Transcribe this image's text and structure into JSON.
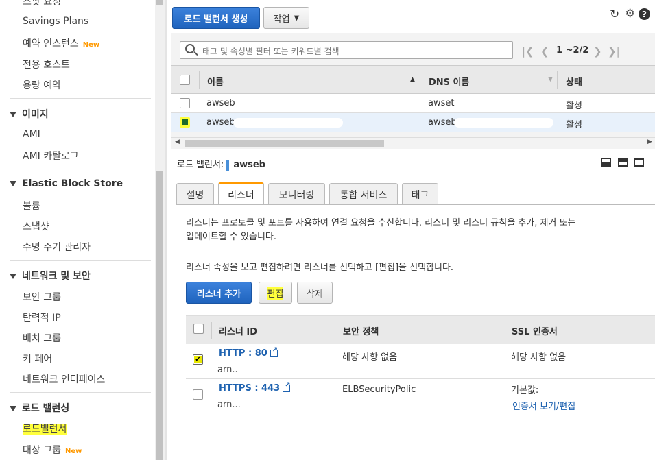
{
  "sidebar": {
    "top_partial": "스팟 요청",
    "items_a": [
      {
        "label": "Savings Plans"
      },
      {
        "label": "예약 인스턴스",
        "badge": "New"
      },
      {
        "label": "전용 호스트"
      },
      {
        "label": "용량 예약"
      }
    ],
    "section_images": "이미지",
    "images_items": [
      {
        "label": "AMI"
      },
      {
        "label": "AMI 카탈로그"
      }
    ],
    "section_ebs": "Elastic Block Store",
    "ebs_items": [
      {
        "label": "볼륨"
      },
      {
        "label": "스냅샷"
      },
      {
        "label": "수명 주기 관리자"
      }
    ],
    "section_network": "네트워크 및 보안",
    "network_items": [
      {
        "label": "보안 그룹"
      },
      {
        "label": "탄력적 IP"
      },
      {
        "label": "배치 그룹"
      },
      {
        "label": "키 페어"
      },
      {
        "label": "네트워크 인터페이스"
      }
    ],
    "section_lb": "로드 밸런싱",
    "lb_items": [
      {
        "label": "로드밸런서"
      },
      {
        "label": "대상 그룹",
        "badge": "New"
      }
    ]
  },
  "toolbar": {
    "create_label": "로드 밸런서 생성",
    "actions_label": "작업",
    "refresh_icon": "refresh-icon",
    "settings_icon": "gear-icon",
    "help_icon": "help-icon"
  },
  "search": {
    "placeholder": "태그 및 속성별 필터 또는 키워드별 검색"
  },
  "pager": {
    "text": "1 ~2/2"
  },
  "lb_table": {
    "columns": [
      "이름",
      "DNS 이름",
      "상태"
    ],
    "rows": [
      {
        "name": "awseb",
        "dns": "awset",
        "state": "활성",
        "selected": false
      },
      {
        "name": "awseb",
        "dns": "awseb",
        "state": "활성",
        "selected": true
      }
    ]
  },
  "detail": {
    "prefix": "로드 밸런서:",
    "name": "awseb",
    "tabs": [
      "설명",
      "리스너",
      "모니터링",
      "통합 서비스",
      "태그"
    ],
    "active_tab": "리스너",
    "desc_line1": "리스너는 프로토콜 및 포트를 사용하여 연결 요청을 수신합니다. 리스너 및 리스너 규칙을 추가, 제거 또는",
    "desc_line2": "업데이트할 수 있습니다.",
    "desc_line3": "리스너 속성을 보고 편집하려면 리스너를 선택하고 [편집]을 선택합니다.",
    "add_listener_label": "리스너 추가",
    "edit_label": "편집",
    "delete_label": "삭제"
  },
  "listener_table": {
    "columns": [
      "리스너 ID",
      "보안 정책",
      "SSL 인증서"
    ],
    "rows": [
      {
        "id": "HTTP : 80",
        "arn": "arn..",
        "policy": "해당 사항 없음",
        "ssl": "해당 사항 없음",
        "ssl_link": "",
        "checked": true
      },
      {
        "id": "HTTPS : 443",
        "arn": "arn...",
        "policy": "ELBSecurityPolic",
        "ssl": "기본값:",
        "ssl_link": "인증서 보기/편집",
        "checked": false
      }
    ]
  },
  "colors": {
    "primary": "#2a6fcc",
    "highlight": "#ffff3c",
    "tab_accent": "#ff9900",
    "link": "#1e62b0"
  }
}
